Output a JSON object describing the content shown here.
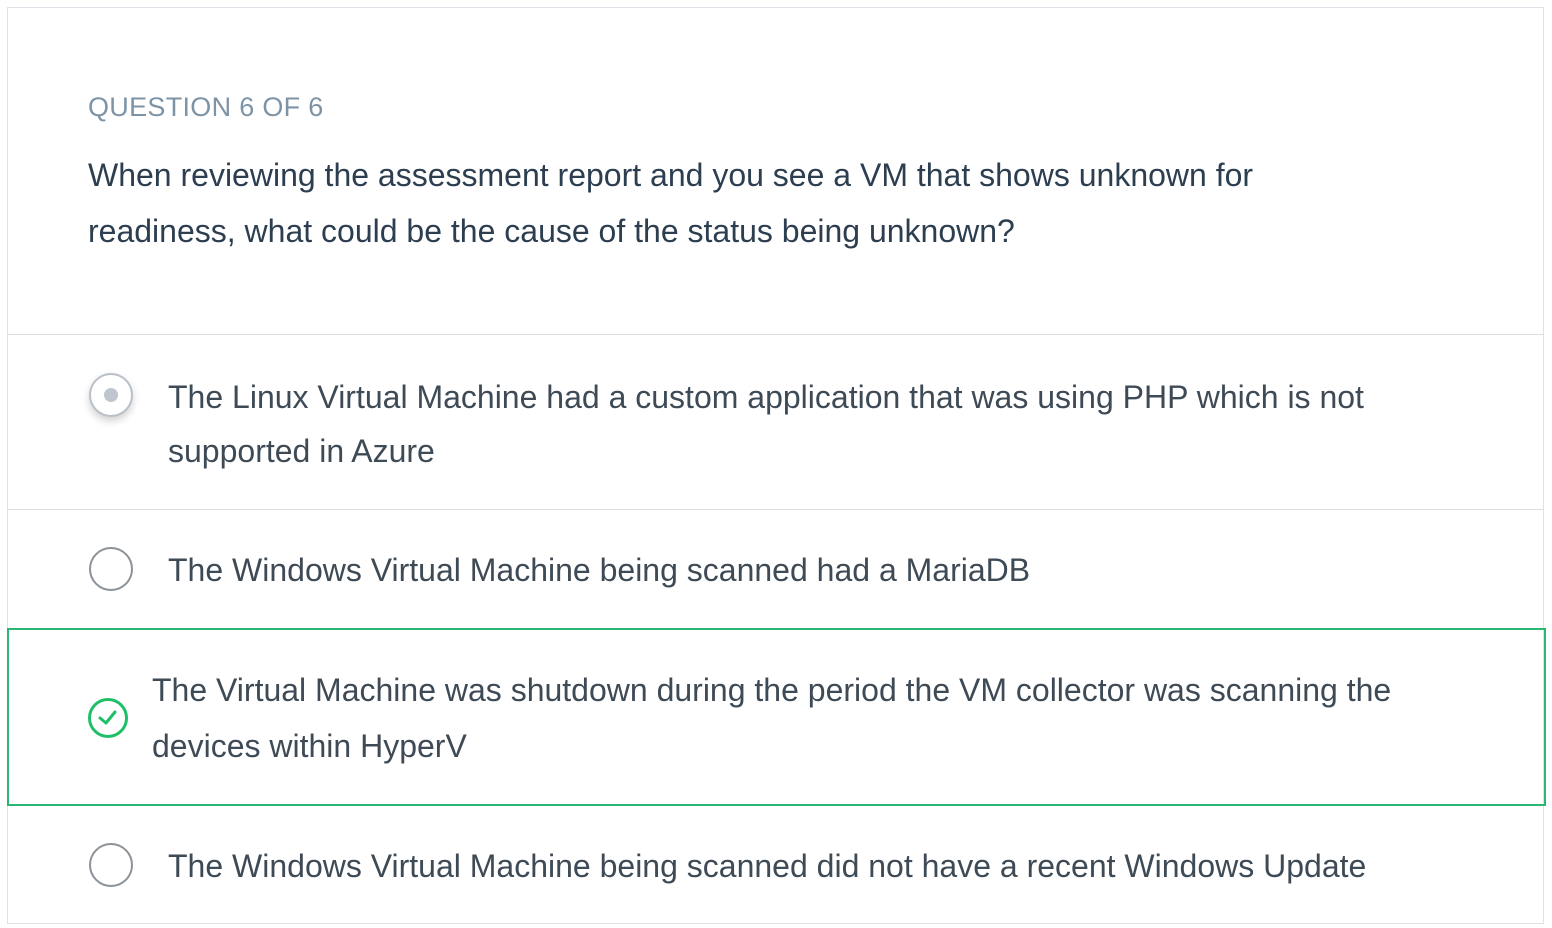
{
  "question": {
    "counter": "QUESTION 6 OF 6",
    "text": "When reviewing the assessment report and you see a VM that shows unknown for readiness, what could be the cause of the status being unknown?"
  },
  "options": [
    {
      "label": "The Linux Virtual Machine had a custom application that was using PHP which is not supported in Azure",
      "state": "hover"
    },
    {
      "label": "The Windows Virtual Machine being scanned had a MariaDB",
      "state": "unselected"
    },
    {
      "label": "The Virtual Machine was shutdown during the period the VM collector was scanning the devices within HyperV",
      "state": "correct"
    },
    {
      "label": "The Windows Virtual Machine being scanned did not have a recent Windows Update",
      "state": "unselected"
    }
  ],
  "colors": {
    "correct": "#1fbf68",
    "counter": "#7d93a6",
    "question_text": "#2c3e50",
    "option_text": "#3e4a55"
  },
  "icons": {
    "radio": "radio-circle-icon",
    "correct": "check-circle-icon"
  }
}
